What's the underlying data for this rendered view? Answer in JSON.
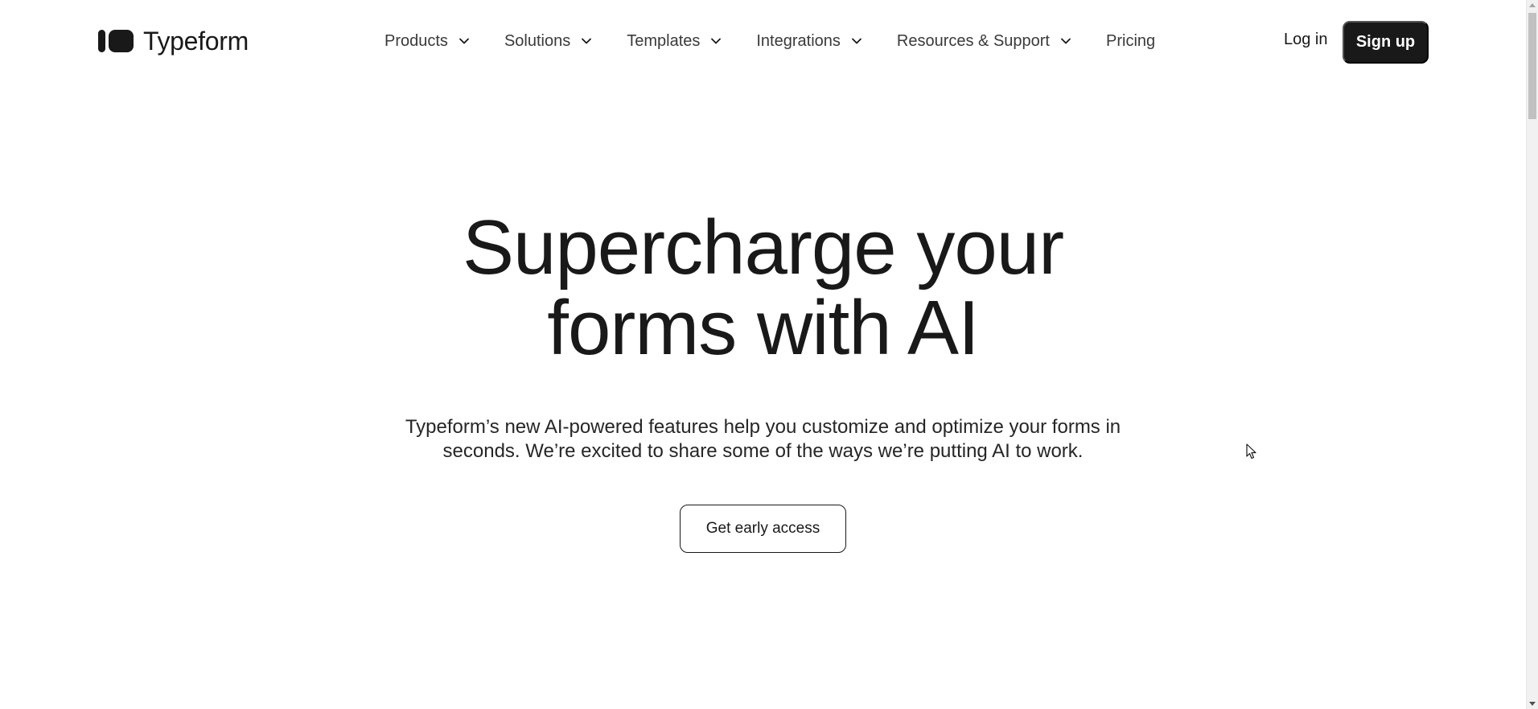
{
  "brand": {
    "name": "Typeform"
  },
  "nav": {
    "items": [
      {
        "label": "Products",
        "has_dropdown": true
      },
      {
        "label": "Solutions",
        "has_dropdown": true
      },
      {
        "label": "Templates",
        "has_dropdown": true
      },
      {
        "label": "Integrations",
        "has_dropdown": true
      },
      {
        "label": "Resources & Support",
        "has_dropdown": true
      },
      {
        "label": "Pricing",
        "has_dropdown": false
      }
    ],
    "login_label": "Log in",
    "signup_label": "Sign up"
  },
  "hero": {
    "title_line1": "Supercharge your",
    "title_line2": "forms with AI",
    "subtitle_line1": "Typeform’s new AI-powered features help you customize and optimize your forms in",
    "subtitle_line2": "seconds. We’re excited to share some of the ways we’re putting AI to work.",
    "cta_label": "Get early access"
  },
  "colors": {
    "text": "#191919",
    "background": "#ffffff",
    "button_dark": "#191919"
  },
  "icons": {
    "dropdown": "chevron-down-icon",
    "logo": "typeform-logo-icon",
    "cursor": "mouse-pointer-icon"
  }
}
